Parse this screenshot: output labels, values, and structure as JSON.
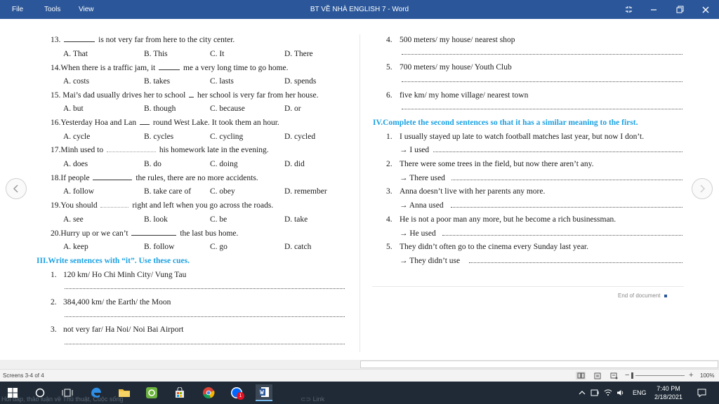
{
  "titlebar": {
    "menu": [
      "File",
      "Tools",
      "View"
    ],
    "title": "BT VỀ  NHÀ ENGLISH 7 - Word"
  },
  "left": {
    "questions": [
      {
        "stem_a": "13. ",
        "stem_b": " is not very far from here to the city center.",
        "options": [
          "A. That",
          "B. This",
          "C. It",
          "D. There"
        ]
      },
      {
        "stem_a": "14.When there is a traffic jam, it ",
        "stem_b": " me a very long time to go home.",
        "options": [
          "A. costs",
          "B. takes",
          "C. lasts",
          "D. spends"
        ]
      },
      {
        "stem_a": "15. Mai’s dad usually drives her to school ",
        "stem_b": " her school is very far from her house.",
        "options": [
          "A. but",
          "B. though",
          "C. because",
          "D. or"
        ]
      },
      {
        "stem_a": "16.Yesterday Hoa and Lan ",
        "stem_b": " round West Lake. It took them an hour.",
        "options": [
          "A. cycle",
          "B. cycles",
          "C. cycling",
          "D. cycled"
        ]
      },
      {
        "stem_a": "17.Minh used to ",
        "stem_b": " his homework late in the evening.",
        "options": [
          "A. does",
          "B. do",
          "C. doing",
          "D. did"
        ]
      },
      {
        "stem_a": "18.If people ",
        "stem_b": " the rules, there are no more accidents.",
        "options": [
          "A. follow",
          "B. take care of",
          "C. obey",
          "D. remember"
        ]
      },
      {
        "stem_a": "19.You should ",
        "stem_b": " right and left when you go across the roads.",
        "options": [
          "A. see",
          "B. look",
          "C. be",
          "D. take"
        ]
      },
      {
        "stem_a": "20.Hurry up or we can’t ",
        "stem_b": " the last bus home.",
        "options": [
          "A. keep",
          "B. follow",
          "C. go",
          "D. catch"
        ]
      }
    ],
    "section3_title": "III.Write sentences with “it”. Use these cues.",
    "cues": [
      {
        "num": "1.",
        "text": "120 km/ Ho Chi Minh City/ Vung Tau"
      },
      {
        "num": "2.",
        "text": "384,400 km/ the Earth/ the Moon"
      },
      {
        "num": "3.",
        "text": "not very far/ Ha Noi/ Noi Bai Airport"
      }
    ]
  },
  "right": {
    "cues": [
      {
        "num": "4.",
        "text": "500 meters/ my house/ nearest shop"
      },
      {
        "num": "5.",
        "text": "700 meters/ my house/ Youth Club"
      },
      {
        "num": "6.",
        "text": "five km/ my home village/ nearest town"
      }
    ],
    "section4_title": "IV.Complete the second sentences so that it has a similar meaning to the first.",
    "items": [
      {
        "num": "1.",
        "text": "I usually stayed up late to watch football matches last year, but now I don’t.",
        "prompt": "→ I used"
      },
      {
        "num": "2.",
        "text": "There were some trees in the field, but now there aren’t any.",
        "prompt": "→ There used"
      },
      {
        "num": "3.",
        "text": "Anna doesn’t live with her parents any more.",
        "prompt": "→ Anna used"
      },
      {
        "num": "4.",
        "text": "He is not a poor man any more, but he become a rich businessman.",
        "prompt": "→ He used"
      },
      {
        "num": "5.",
        "text": "They didn’t often go to the cinema every Sunday last year.",
        "prompt": "→ They didn’t use"
      }
    ],
    "end_of_document": "End of document"
  },
  "status": {
    "pages": "Screens 3-4 of 4",
    "zoom": "100%"
  },
  "taskbar": {
    "language": "ENG",
    "time": "7:40 PM",
    "date": "2/18/2021",
    "badge": "1",
    "ghost_left": "Hỏi đáp, thảo luận về Thủ thuật, Cuộc sống",
    "ghost_link": "Link"
  },
  "colors": {
    "title_bar": "#2b579a",
    "heading": "#1ba1e2",
    "taskbar": "#1f2a36"
  }
}
